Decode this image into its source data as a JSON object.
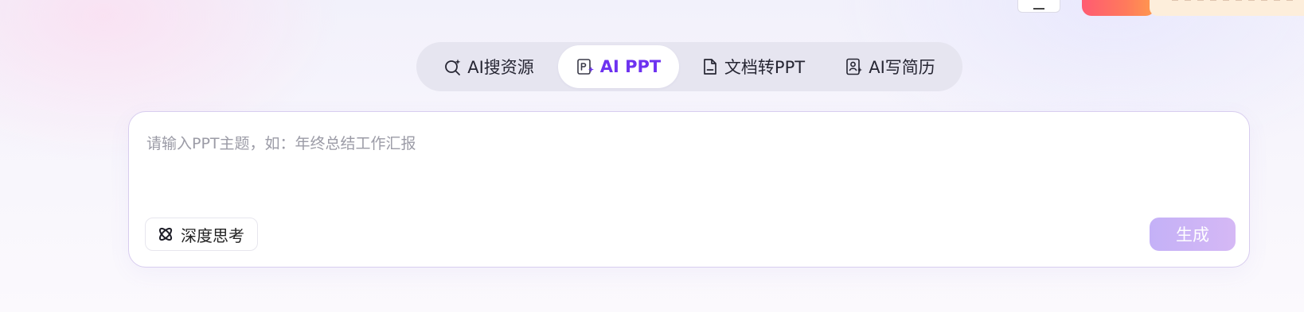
{
  "tabs": [
    {
      "id": "ai-search",
      "label": "AI搜资源",
      "icon": "magnify-sparkle-icon",
      "active": false
    },
    {
      "id": "ai-ppt",
      "label": "AI PPT",
      "icon": "slide-sparkle-icon",
      "active": true
    },
    {
      "id": "doc-to-ppt",
      "label": "文档转PPT",
      "icon": "document-icon",
      "active": false
    },
    {
      "id": "ai-resume",
      "label": "AI写简历",
      "icon": "resume-sparkle-icon",
      "active": false
    }
  ],
  "input": {
    "value": "",
    "placeholder": "请输入PPT主题，如：年终总结工作汇报"
  },
  "deep_think": {
    "label": "深度思考",
    "icon": "atom-orbit-icon"
  },
  "generate": {
    "label": "生成"
  },
  "colors": {
    "accent": "#6d32f0",
    "tab_bar_bg": "#e6e5f0",
    "generate_gradient_start": "#c4b1f7",
    "generate_gradient_end": "#d5b8f5",
    "top_badge": "#ff6b66",
    "top_promo": "#fdeedb"
  }
}
